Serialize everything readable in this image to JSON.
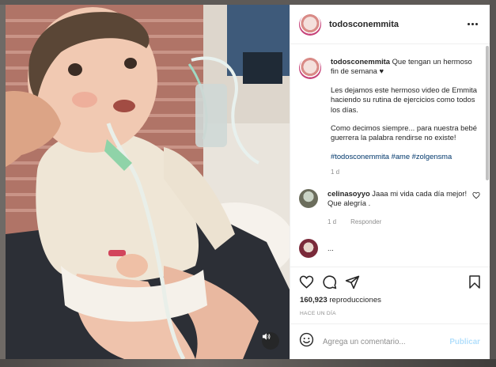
{
  "post": {
    "username": "todosconemmita",
    "caption_text": "Que tengan un hermoso fin de semana ♥",
    "paragraphs": [
      "Les dejamos este hermoso video de Emmita haciendo su rutina de ejercicios como todos los días.",
      "Como decimos siempre... para nuestra bebé guerrera la palabra rendirse no existe!"
    ],
    "hashtags": "#todosconemmita #ame #zolgensma",
    "age": "1 d"
  },
  "comments": [
    {
      "username": "celinasoyyo",
      "text": "Jaaa mi vida cada día mejor! Que alegría .",
      "age": "1 d",
      "reply_label": "Responder"
    }
  ],
  "peek_comment": "...",
  "stats": {
    "views_count": "160,923",
    "views_label": "reproducciones",
    "posted": "HACE UN DÍA"
  },
  "composer": {
    "placeholder": "Agrega un comentario...",
    "publish_label": "Publicar"
  },
  "icons": {
    "header_more": "more-options-icon",
    "like": "heart-icon",
    "comment": "comment-bubble-icon",
    "share": "paper-plane-icon",
    "save": "bookmark-icon",
    "emoji": "smiley-icon",
    "sound": "speaker-icon"
  },
  "colors": {
    "link": "#00376b",
    "publish_disabled": "#b2dffc",
    "muted": "#8e8e8e"
  }
}
